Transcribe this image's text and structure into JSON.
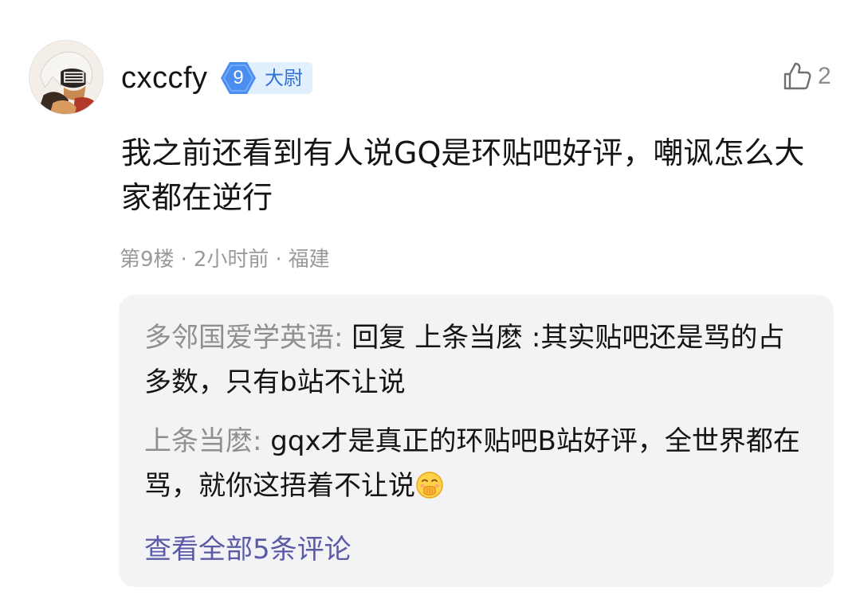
{
  "comment": {
    "username": "cxccfy",
    "level_number": "9",
    "level_title": "大尉",
    "like_count": "2",
    "text": "我之前还看到有人说GQ是环贴吧好评，嘲讽怎么大家都在逆行",
    "floor": "第9楼",
    "separator": "·",
    "time": "2小时前",
    "location": "福建"
  },
  "replies": [
    {
      "author": "多邻国爱学英语:",
      "text": " 回复 上条当麽 :其实贴吧还是骂的占多数，只有b站不让说",
      "emoji": ""
    },
    {
      "author": "上条当麽:",
      "text": " gqx才是真正的环贴吧B站好评，全世界都在骂，就你这捂着不让说",
      "emoji": "covering-mouth-emoji"
    }
  ],
  "view_all_label": "查看全部5条评论",
  "icons": {
    "like": "thumbs-up-icon",
    "level": "level-badge-icon"
  },
  "colors": {
    "level_badge": "#4a8ff0",
    "level_title_bg": "#e2efff",
    "level_title_text": "#2f71d6",
    "reply_author": "#8f8f8f",
    "view_all": "#5a5aa6",
    "meta": "#9a9a9a"
  }
}
